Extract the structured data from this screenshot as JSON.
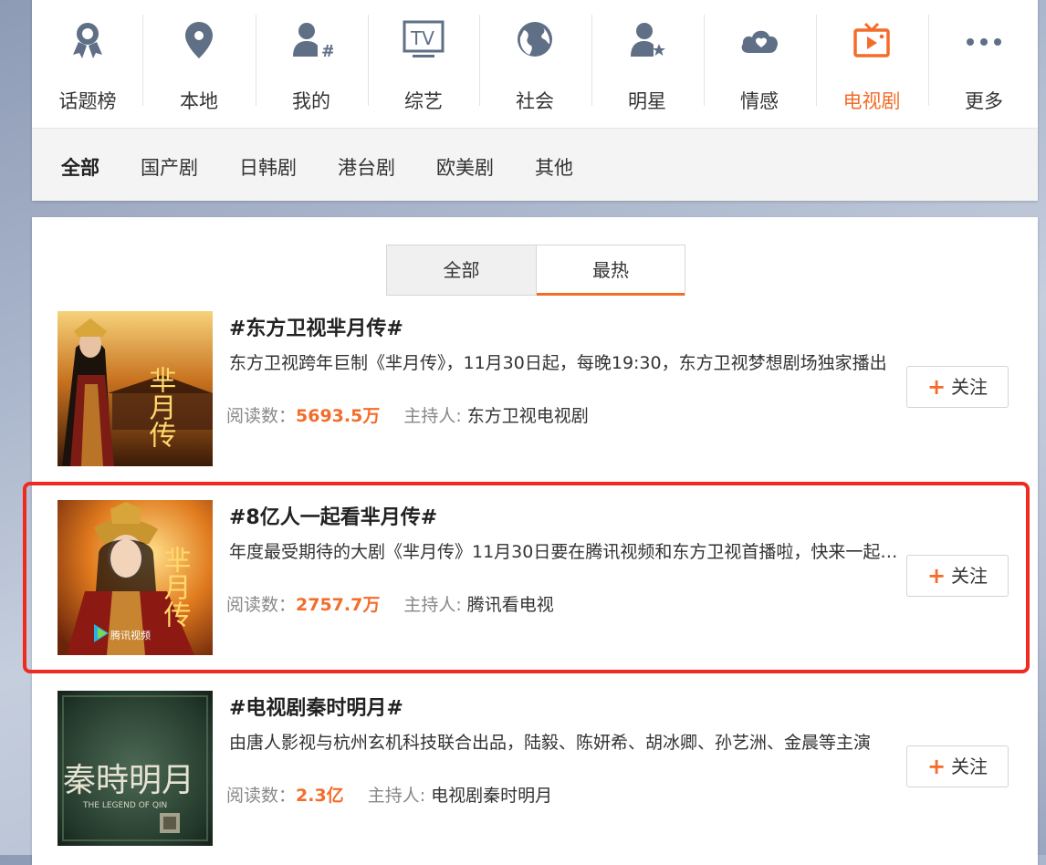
{
  "categories": [
    {
      "label": "话题榜",
      "icon": "award-icon"
    },
    {
      "label": "本地",
      "icon": "location-pin-icon"
    },
    {
      "label": "我的",
      "icon": "user-hashtag-icon"
    },
    {
      "label": "综艺",
      "icon": "tv-icon"
    },
    {
      "label": "社会",
      "icon": "globe-icon"
    },
    {
      "label": "明星",
      "icon": "star-user-icon"
    },
    {
      "label": "情感",
      "icon": "cloud-heart-icon"
    },
    {
      "label": "电视剧",
      "icon": "television-icon",
      "active": true
    },
    {
      "label": "更多",
      "icon": "more-dots-icon"
    }
  ],
  "sub_nav": [
    "全部",
    "国产剧",
    "日韩剧",
    "港台剧",
    "欧美剧",
    "其他"
  ],
  "segment": {
    "all": "全部",
    "hot": "最热"
  },
  "labels": {
    "reads": "阅读数：",
    "host": "主持人: ",
    "follow": "关注",
    "plus": "+"
  },
  "topics": [
    {
      "title": "#东方卫视芈月传#",
      "desc": "东方卫视跨年巨制《芈月传》，11月30日起，每晚19:30，东方卫视梦想剧场独家播出",
      "reads": "5693.5万",
      "host": "东方卫视电视剧",
      "poster_text": "芈月传"
    },
    {
      "title": "#8亿人一起看芈月传#",
      "desc": "年度最受期待的大剧《芈月传》11月30日要在腾讯视频和东方卫视首播啦，快来一起看吧",
      "reads": "2757.7万",
      "host": "腾讯看电视",
      "poster_text": "芈月传",
      "poster_badge": "腾讯视频"
    },
    {
      "title": "#电视剧秦时明月#",
      "desc": "由唐人影视与杭州玄机科技联合出品，陆毅、陈妍希、胡冰卿、孙艺洲、金晨等主演",
      "reads": "2.3亿",
      "host": "电视剧秦时明月",
      "poster_text": "秦時明月",
      "poster_subtitle": "THE LEGEND OF QIN"
    }
  ],
  "colors": {
    "accent": "#f46c2a",
    "highlight": "#ef2a1e",
    "icon": "#5f6f86"
  }
}
